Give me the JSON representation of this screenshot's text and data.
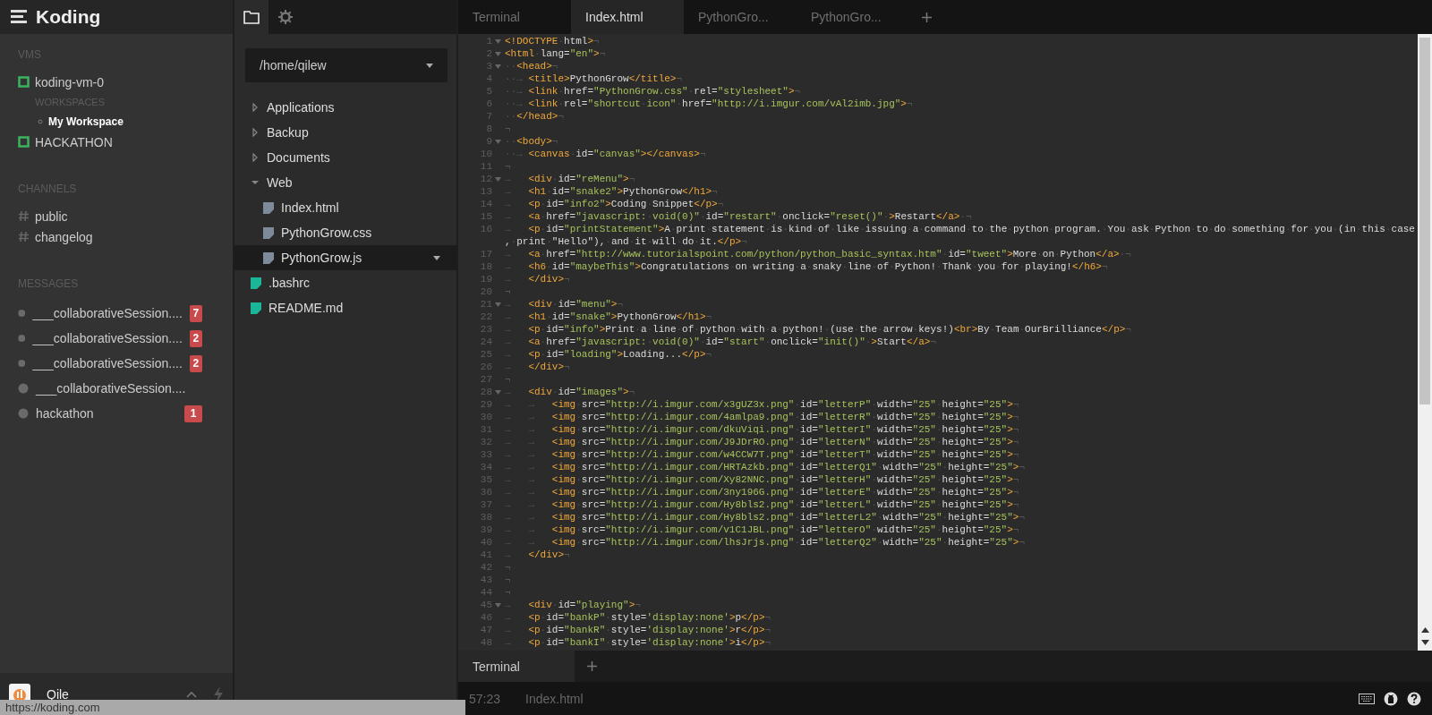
{
  "app": {
    "logo": "Koding"
  },
  "vms": {
    "heading": "VMS",
    "items": [
      {
        "name": "koding-vm-0",
        "workspaces_heading": "WORKSPACES",
        "workspaces": [
          {
            "name": "My Workspace",
            "selected": true
          }
        ]
      },
      {
        "name": "HACKATHON"
      }
    ]
  },
  "channels": {
    "heading": "CHANNELS",
    "items": [
      "public",
      "changelog"
    ]
  },
  "messages": {
    "heading": "MESSAGES",
    "items": [
      {
        "name": "___collaborativeSession....",
        "badge": "7"
      },
      {
        "name": "___collaborativeSession....",
        "badge": "2"
      },
      {
        "name": "___collaborativeSession....",
        "badge": "2"
      },
      {
        "name": "___collaborativeSession...."
      },
      {
        "name": "hackathon",
        "badge": "1"
      }
    ]
  },
  "user": {
    "name": "Qile"
  },
  "file_tree": {
    "path": "/home/qilew",
    "items": [
      {
        "name": "Applications",
        "kind": "folder",
        "expanded": false,
        "selected": false
      },
      {
        "name": "Backup",
        "kind": "folder",
        "expanded": false,
        "selected": false
      },
      {
        "name": "Documents",
        "kind": "folder",
        "expanded": false,
        "selected": false
      },
      {
        "name": "Web",
        "kind": "folder",
        "expanded": true,
        "selected": false,
        "children": [
          {
            "name": "Index.html",
            "kind": "file",
            "selected": false
          },
          {
            "name": "PythonGrow.css",
            "kind": "file",
            "selected": false
          },
          {
            "name": "PythonGrow.js",
            "kind": "file",
            "selected": true
          }
        ]
      },
      {
        "name": ".bashrc",
        "kind": "file",
        "selected": false
      },
      {
        "name": "README.md",
        "kind": "file",
        "selected": false
      }
    ]
  },
  "editor_tabs": [
    {
      "label": "Terminal",
      "selected": false
    },
    {
      "label": "Index.html",
      "selected": true
    },
    {
      "label": "PythonGro...",
      "selected": false
    },
    {
      "label": "PythonGro...",
      "selected": false
    }
  ],
  "code": {
    "lines": [
      {
        "number": "1",
        "foldable": true,
        "text": "<!DOCTYPE·html>¬"
      },
      {
        "number": "2",
        "foldable": true,
        "text": "<html·lang=\"en\">¬"
      },
      {
        "number": "3",
        "foldable": true,
        "text": "··<head>¬"
      },
      {
        "number": "4",
        "foldable": false,
        "text": "··→ <title>PythonGrow</title>¬"
      },
      {
        "number": "5",
        "foldable": false,
        "text": "··→ <link·href=\"PythonGrow.css\"·rel=\"stylesheet\">¬"
      },
      {
        "number": "6",
        "foldable": false,
        "text": "··→ <link·rel=\"shortcut·icon\"·href=\"http://i.imgur.com/vAl2imb.jpg\">¬"
      },
      {
        "number": "7",
        "foldable": false,
        "text": "··</head>¬"
      },
      {
        "number": "8",
        "foldable": false,
        "text": "¬"
      },
      {
        "number": "9",
        "foldable": true,
        "text": "··<body>¬"
      },
      {
        "number": "10",
        "foldable": false,
        "text": "··→ <canvas·id=\"canvas\"></canvas>¬"
      },
      {
        "number": "11",
        "foldable": false,
        "text": "¬"
      },
      {
        "number": "12",
        "foldable": true,
        "text": "→   <div·id=\"reMenu\">¬"
      },
      {
        "number": "13",
        "foldable": false,
        "text": "→   <h1·id=\"snake2\">PythonGrow</h1>¬"
      },
      {
        "number": "14",
        "foldable": false,
        "text": "→   <p·id=\"info2\">Coding·Snippet</p>¬"
      },
      {
        "number": "15",
        "foldable": false,
        "text": "→   <a·href=\"javascript:·void(0)\"·id=\"restart\"·onclick=\"reset()\"·>Restart</a>·¬"
      },
      {
        "number": "16",
        "foldable": false,
        "text": "→   <p·id=\"printStatement\">A·print·statement·is·kind·of·like·issuing·a·command·to·the·python·program.·You·ask·Python·to·do·something·for·you·(in·this·case",
        "wrap": ",·print·\"Hello\"),·and·it·will·do·it.</p>¬"
      },
      {
        "number": "17",
        "foldable": false,
        "text": "→   <a·href=\"http://www.tutorialspoint.com/python/python_basic_syntax.htm\"·id=\"tweet\">More·on·Python</a>·¬"
      },
      {
        "number": "18",
        "foldable": false,
        "text": "→   <h6·id=\"maybeThis\">Congratulations·on·writing·a·snaky·line·of·Python!·Thank·you·for·playing!</h6>¬"
      },
      {
        "number": "19",
        "foldable": false,
        "text": "→   </div>¬"
      },
      {
        "number": "20",
        "foldable": false,
        "text": "¬"
      },
      {
        "number": "21",
        "foldable": true,
        "text": "→   <div·id=\"menu\">¬"
      },
      {
        "number": "22",
        "foldable": false,
        "text": "→   <h1·id=\"snake\">PythonGrow</h1>¬"
      },
      {
        "number": "23",
        "foldable": false,
        "text": "→   <p·id=\"info\">Print·a·line·of·python·with·a·python!·(use·the·arrow·keys!)<br>By·Team·OurBrilliance</p>¬"
      },
      {
        "number": "24",
        "foldable": false,
        "text": "→   <a·href=\"javascript:·void(0)\"·id=\"start\"·onclick=\"init()\"·>Start</a>¬"
      },
      {
        "number": "25",
        "foldable": false,
        "text": "→   <p·id=\"loading\">Loading...</p>¬"
      },
      {
        "number": "26",
        "foldable": false,
        "text": "→   </div>¬"
      },
      {
        "number": "27",
        "foldable": false,
        "text": "¬"
      },
      {
        "number": "28",
        "foldable": true,
        "text": "→   <div·id=\"images\">¬"
      },
      {
        "number": "29",
        "foldable": false,
        "text": "→   →   <img·src=\"http://i.imgur.com/x3gUZ3x.png\"·id=\"letterP\"·width=\"25\"·height=\"25\">¬"
      },
      {
        "number": "30",
        "foldable": false,
        "text": "→   →   <img·src=\"http://i.imgur.com/4amlpa9.png\"·id=\"letterR\"·width=\"25\"·height=\"25\">¬"
      },
      {
        "number": "31",
        "foldable": false,
        "text": "→   →   <img·src=\"http://i.imgur.com/dkuViqi.png\"·id=\"letterI\"·width=\"25\"·height=\"25\">¬"
      },
      {
        "number": "32",
        "foldable": false,
        "text": "→   →   <img·src=\"http://i.imgur.com/J9JDrRO.png\"·id=\"letterN\"·width=\"25\"·height=\"25\">¬"
      },
      {
        "number": "33",
        "foldable": false,
        "text": "→   →   <img·src=\"http://i.imgur.com/w4CCW7T.png\"·id=\"letterT\"·width=\"25\"·height=\"25\">¬"
      },
      {
        "number": "34",
        "foldable": false,
        "text": "→   →   <img·src=\"http://i.imgur.com/HRTAzkb.png\"·id=\"letterQ1\"·width=\"25\"·height=\"25\">¬"
      },
      {
        "number": "35",
        "foldable": false,
        "text": "→   →   <img·src=\"http://i.imgur.com/Xy82NNC.png\"·id=\"letterH\"·width=\"25\"·height=\"25\">¬"
      },
      {
        "number": "36",
        "foldable": false,
        "text": "→   →   <img·src=\"http://i.imgur.com/3ny196G.png\"·id=\"letterE\"·width=\"25\"·height=\"25\">¬"
      },
      {
        "number": "37",
        "foldable": false,
        "text": "→   →   <img·src=\"http://i.imgur.com/Hy8bls2.png\"·id=\"letterL\"·width=\"25\"·height=\"25\">¬"
      },
      {
        "number": "38",
        "foldable": false,
        "text": "→   →   <img·src=\"http://i.imgur.com/Hy8bls2.png\"·id=\"letterL2\"·width=\"25\"·height=\"25\">¬"
      },
      {
        "number": "39",
        "foldable": false,
        "text": "→   →   <img·src=\"http://i.imgur.com/v1C1JBL.png\"·id=\"letterO\"·width=\"25\"·height=\"25\">¬"
      },
      {
        "number": "40",
        "foldable": false,
        "text": "→   →   <img·src=\"http://i.imgur.com/lhsJrjs.png\"·id=\"letterQ2\"·width=\"25\"·height=\"25\">¬"
      },
      {
        "number": "41",
        "foldable": false,
        "text": "→   </div>¬"
      },
      {
        "number": "42",
        "foldable": false,
        "text": "¬"
      },
      {
        "number": "43",
        "foldable": false,
        "text": "¬"
      },
      {
        "number": "44",
        "foldable": false,
        "text": "¬"
      },
      {
        "number": "45",
        "foldable": true,
        "text": "→   <div·id=\"playing\">¬"
      },
      {
        "number": "46",
        "foldable": false,
        "text": "→   <p·id=\"bankP\"·style='display:none'>p</p>¬"
      },
      {
        "number": "47",
        "foldable": false,
        "text": "→   <p·id=\"bankR\"·style='display:none'>r</p>¬"
      },
      {
        "number": "48",
        "foldable": false,
        "text": "→   <p·id=\"bankI\"·style='display:none'>i</p>¬"
      }
    ]
  },
  "terminal_tabs": [
    {
      "label": "Terminal",
      "selected": true
    }
  ],
  "status_bar": {
    "position": "57:23",
    "file": "Index.html"
  },
  "browser_status": "https://koding.com"
}
